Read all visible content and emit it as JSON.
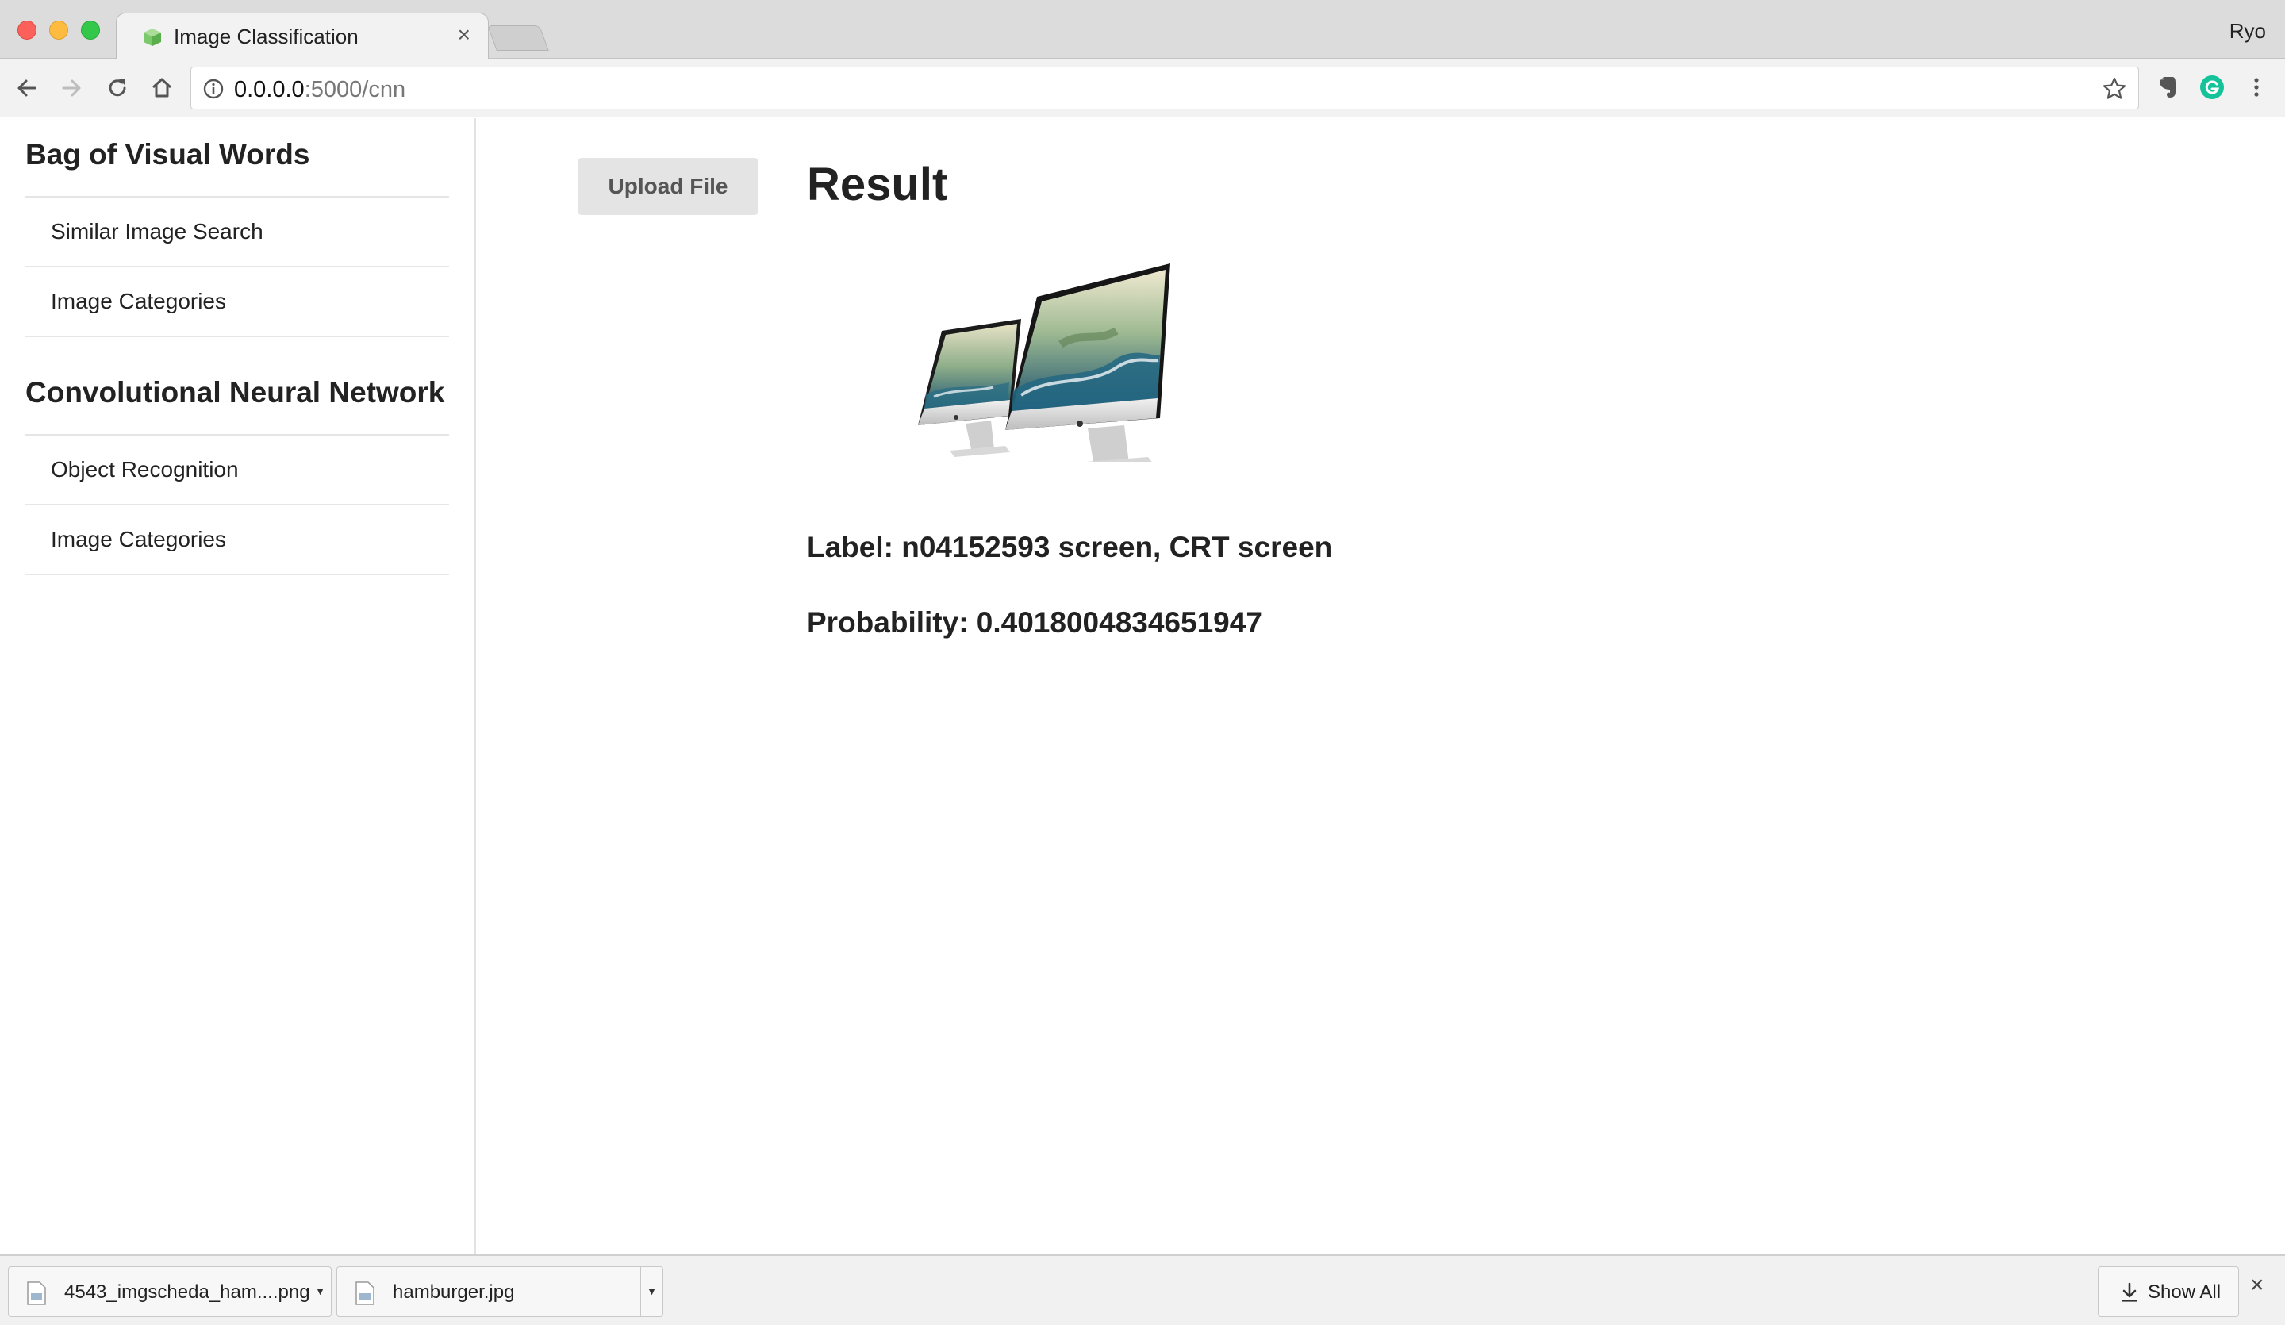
{
  "browser": {
    "tab_title": "Image Classification",
    "tab_close": "×",
    "profile_name": "Ryo",
    "url_host": "0.0.0.0",
    "url_path": ":5000/cnn"
  },
  "sidebar": {
    "sections": [
      {
        "heading": "Bag of Visual Words",
        "items": [
          {
            "label": "Similar Image Search"
          },
          {
            "label": "Image Categories"
          }
        ]
      },
      {
        "heading": "Convolutional Neural Network",
        "items": [
          {
            "label": "Object Recognition"
          },
          {
            "label": "Image Categories"
          }
        ]
      }
    ]
  },
  "main": {
    "upload_button": "Upload File",
    "result_title": "Result",
    "label_line": "Label: n04152593 screen, CRT screen",
    "probability_line": "Probability: 0.4018004834651947"
  },
  "downloads": {
    "items": [
      {
        "name": "4543_imgscheda_ham....png"
      },
      {
        "name": "hamburger.jpg"
      }
    ],
    "show_all": "Show All",
    "close": "×"
  },
  "colors": {
    "favicon_green": "#7cc96c",
    "grammarly_green": "#15c39a"
  }
}
